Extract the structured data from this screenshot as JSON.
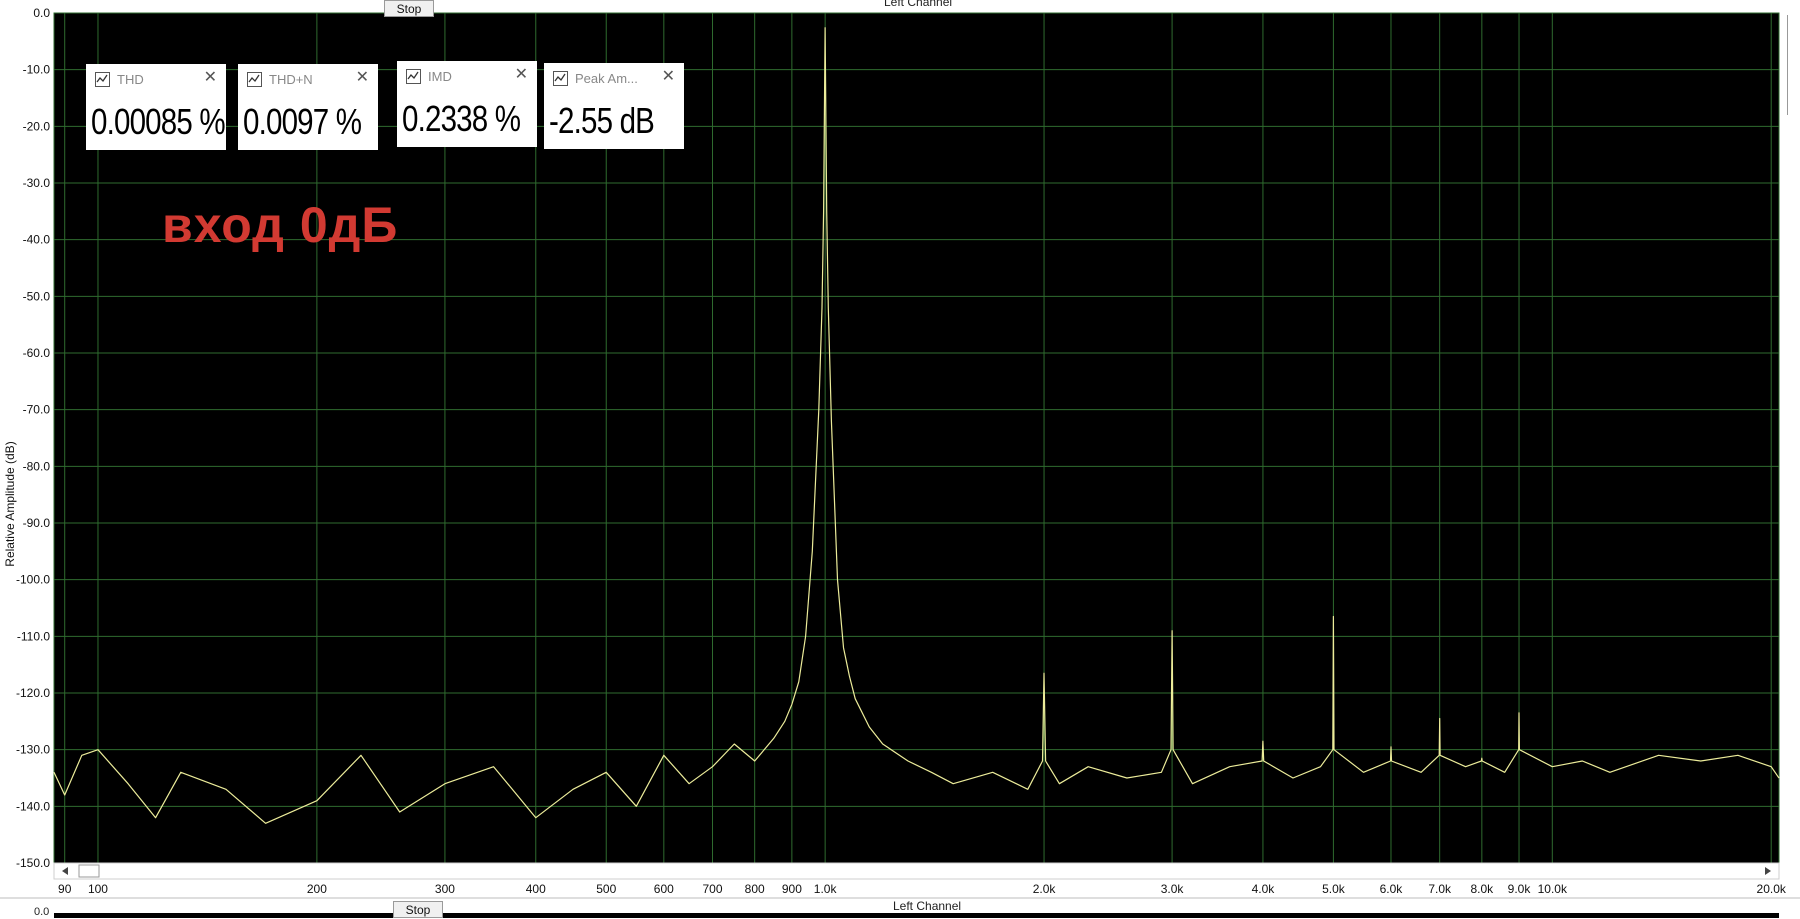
{
  "top_panel": {
    "stop_label": "Stop",
    "title": "Left Channel",
    "y_axis_label": "Relative Amplitude (dB)"
  },
  "bottom_panel": {
    "stop_label": "Stop",
    "title": "Left Channel",
    "y_top_label": "0.0"
  },
  "meters": [
    {
      "label": "THD",
      "value": "0.00085 %"
    },
    {
      "label": "THD+N",
      "value": "0.0097 %"
    },
    {
      "label": "IMD",
      "value": "0.2338 %"
    },
    {
      "label": "Peak Am...",
      "value": "-2.55 dB"
    }
  ],
  "overlay_note": "вход 0дБ",
  "colors": {
    "plot_background": "#000000",
    "grid": "#2f6b2f",
    "trace": "#ecec9a",
    "annotation": "#d23a32"
  },
  "chart_data": {
    "type": "line",
    "title": "Left Channel",
    "xlabel": "",
    "ylabel": "Relative Amplitude (dB)",
    "x_scale": "log",
    "xlim": [
      87,
      20500
    ],
    "ylim": [
      -150,
      0
    ],
    "grid": true,
    "x_ticks": [
      {
        "v": 90,
        "label": "90"
      },
      {
        "v": 100,
        "label": "100"
      },
      {
        "v": 200,
        "label": "200"
      },
      {
        "v": 300,
        "label": "300"
      },
      {
        "v": 400,
        "label": "400"
      },
      {
        "v": 500,
        "label": "500"
      },
      {
        "v": 600,
        "label": "600"
      },
      {
        "v": 700,
        "label": "700"
      },
      {
        "v": 800,
        "label": "800"
      },
      {
        "v": 900,
        "label": "900"
      },
      {
        "v": 1000,
        "label": "1.0k"
      },
      {
        "v": 2000,
        "label": "2.0k"
      },
      {
        "v": 3000,
        "label": "3.0k"
      },
      {
        "v": 4000,
        "label": "4.0k"
      },
      {
        "v": 5000,
        "label": "5.0k"
      },
      {
        "v": 6000,
        "label": "6.0k"
      },
      {
        "v": 7000,
        "label": "7.0k"
      },
      {
        "v": 8000,
        "label": "8.0k"
      },
      {
        "v": 9000,
        "label": "9.0k"
      },
      {
        "v": 10000,
        "label": "10.0k"
      },
      {
        "v": 20000,
        "label": "20.0k"
      }
    ],
    "y_ticks": [
      {
        "v": 0,
        "label": "0.0"
      },
      {
        "v": -10,
        "label": "-10.0"
      },
      {
        "v": -20,
        "label": "-20.0"
      },
      {
        "v": -30,
        "label": "-30.0"
      },
      {
        "v": -40,
        "label": "-40.0"
      },
      {
        "v": -50,
        "label": "-50.0"
      },
      {
        "v": -60,
        "label": "-60.0"
      },
      {
        "v": -70,
        "label": "-70.0"
      },
      {
        "v": -80,
        "label": "-80.0"
      },
      {
        "v": -90,
        "label": "-90.0"
      },
      {
        "v": -100,
        "label": "-100.0"
      },
      {
        "v": -110,
        "label": "-110.0"
      },
      {
        "v": -120,
        "label": "-120.0"
      },
      {
        "v": -130,
        "label": "-130.0"
      },
      {
        "v": -140,
        "label": "-140.0"
      },
      {
        "v": -150,
        "label": "-150.0"
      }
    ],
    "series": [
      {
        "x": [
          87,
          90,
          95,
          100,
          110,
          120,
          130,
          150,
          170,
          200,
          230,
          260,
          300,
          350,
          400,
          450,
          500,
          550,
          600,
          650,
          700,
          750,
          800,
          850,
          880,
          900,
          920,
          940,
          960,
          980,
          990,
          995,
          1000,
          1005,
          1010,
          1020,
          1040,
          1060,
          1080,
          1100,
          1150,
          1200,
          1300,
          1400,
          1500,
          1700,
          1900,
          1990,
          2000,
          2010,
          2100,
          2300,
          2600,
          2900,
          2990,
          3000,
          3010,
          3200,
          3600,
          3990,
          4000,
          4010,
          4400,
          4800,
          4990,
          5000,
          5010,
          5500,
          5990,
          6000,
          6010,
          6600,
          6990,
          7000,
          7010,
          7600,
          7990,
          8000,
          8010,
          8600,
          8990,
          9000,
          9010,
          10000,
          11000,
          12000,
          14000,
          16000,
          18000,
          20000,
          20500
        ],
        "y": [
          -134,
          -138,
          -131,
          -130,
          -136,
          -142,
          -134,
          -137,
          -143,
          -139,
          -131,
          -141,
          -136,
          -133,
          -142,
          -137,
          -134,
          -140,
          -131,
          -136,
          -133,
          -129,
          -132,
          -128,
          -125,
          -122,
          -118,
          -110,
          -95,
          -70,
          -52,
          -35,
          -2.6,
          -35,
          -52,
          -72,
          -100,
          -112,
          -117,
          -121,
          -126,
          -129,
          -132,
          -134,
          -136,
          -134,
          -137,
          -132,
          -116.5,
          -132,
          -136,
          -133,
          -135,
          -134,
          -130,
          -109,
          -130,
          -136,
          -133,
          -132,
          -128.5,
          -132,
          -135,
          -133,
          -130,
          -106.5,
          -130,
          -134,
          -132,
          -129.5,
          -132,
          -134,
          -131,
          -124.5,
          -131,
          -133,
          -132,
          -131.5,
          -132,
          -134,
          -130,
          -123.5,
          -130,
          -133,
          -132,
          -134,
          -131,
          -132,
          -131,
          -133,
          -135
        ]
      }
    ]
  }
}
